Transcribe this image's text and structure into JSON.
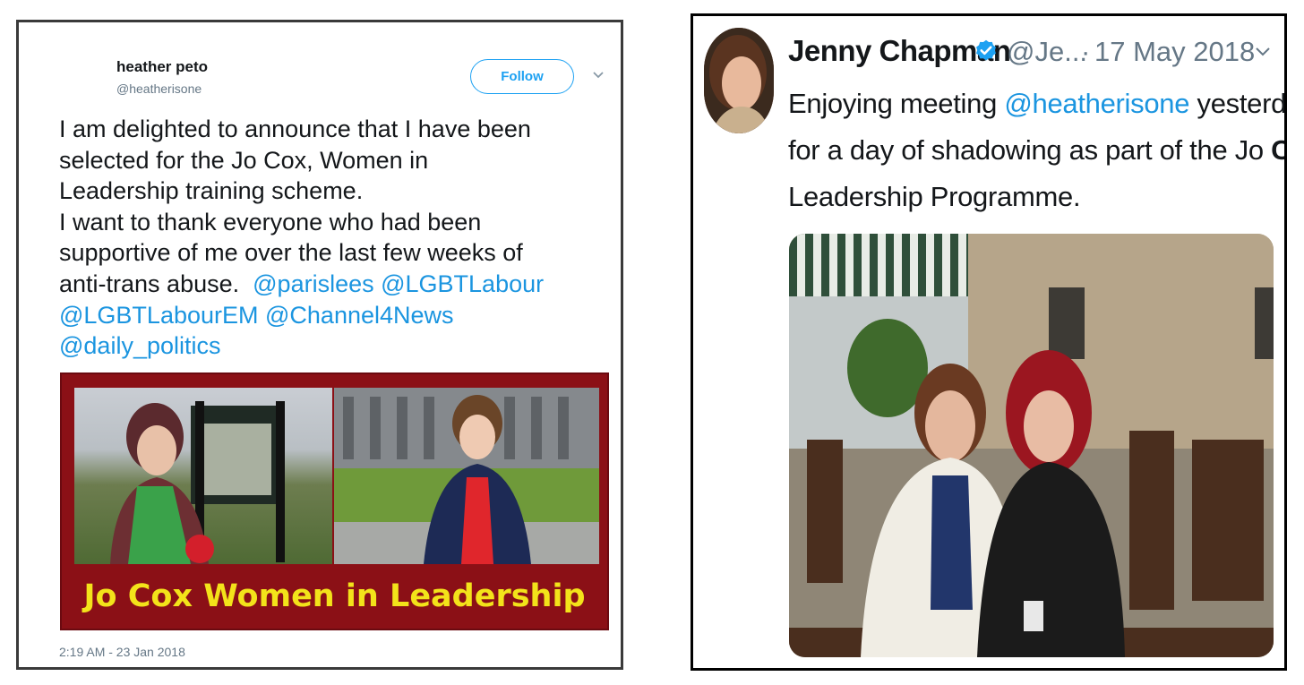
{
  "left_tweet": {
    "name": "heather peto",
    "handle": "@heatherisone",
    "follow_label": "Follow",
    "text_lines": [
      "I am delighted to announce that I have been",
      "selected for the Jo Cox, Women in",
      "Leadership training scheme.",
      "I want to thank everyone who had been",
      "supportive of me over the last few weeks of"
    ],
    "line6_text": "anti-trans abuse.",
    "line6_mentions": "@parislees @LGBTLabour",
    "line7_mentions": "@LGBTLabourEM @Channel4News",
    "line8_mentions": "@daily_politics",
    "image_caption": "Jo Cox Women in Leadership",
    "timestamp": "2:19 AM - 23 Jan 2018"
  },
  "right_tweet": {
    "name": "Jenny Chapman",
    "handle": "@Je...",
    "separator": "·",
    "date": "17 May 2018",
    "text_line1_pre": "Enjoying meeting",
    "text_line1_mention": "@heatherisone",
    "text_line1_post": "yesterday",
    "text_line2_pre": "for a day of shadowing as part of the Jo",
    "text_line2_bold": "Cox",
    "text_line3": "Leadership Programme."
  },
  "colors": {
    "mention": "#1b95e0",
    "banner_bg": "#8b1016",
    "banner_text": "#f3e31a",
    "verified": "#1da1f2"
  },
  "icons": [
    "chevron-down-icon",
    "verified-badge-icon"
  ]
}
